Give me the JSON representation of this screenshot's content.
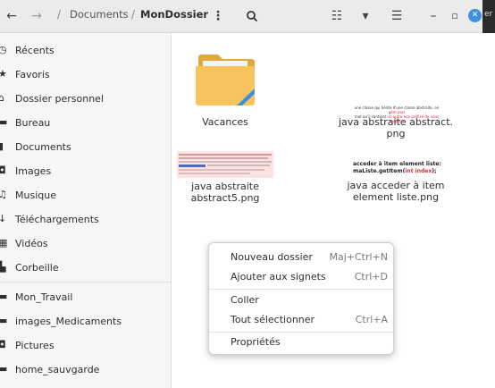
{
  "header": {
    "back_glyph": "←",
    "forward_glyph": "→",
    "breadcrumb": [
      "Documents",
      "MonDossier"
    ],
    "separator": "/",
    "menu_glyph": "⋮",
    "search_glyph": "🔍",
    "view_glyph": "☷",
    "sort_glyph": "▾",
    "options_glyph": "☰",
    "minimize_glyph": "–",
    "maximize_glyph": "▫",
    "close_glyph": "✕",
    "close_color": "#3b8ee0"
  },
  "sidebar": {
    "items": [
      {
        "icon": "clock-icon",
        "glyph": "◷",
        "label": "Récents"
      },
      {
        "icon": "star-icon",
        "glyph": "★",
        "label": "Favoris"
      },
      {
        "icon": "home-icon",
        "glyph": "⌂",
        "label": "Dossier personnel"
      },
      {
        "icon": "desktop-icon",
        "glyph": "▬",
        "label": "Bureau"
      },
      {
        "icon": "document-icon",
        "glyph": "▮",
        "label": "Documents"
      },
      {
        "icon": "camera-icon",
        "glyph": "◘",
        "label": "Images"
      },
      {
        "icon": "music-icon",
        "glyph": "♫",
        "label": "Musique"
      },
      {
        "icon": "download-icon",
        "glyph": "↓",
        "label": "Téléchargements"
      },
      {
        "icon": "film-icon",
        "glyph": "▦",
        "label": "Vidéos"
      },
      {
        "icon": "trash-icon",
        "glyph": "▙",
        "label": "Corbeille"
      },
      {
        "icon": "folder-icon",
        "glyph": "▬",
        "label": "Mon_Travail"
      },
      {
        "icon": "folder-icon",
        "glyph": "▬",
        "label": "images_Medicaments"
      },
      {
        "icon": "pictures-icon",
        "glyph": "◘",
        "label": "Pictures"
      },
      {
        "icon": "folder-icon",
        "glyph": "▬",
        "label": "home_sauvgarde"
      }
    ]
  },
  "files": [
    {
      "name": "Vacances",
      "kind": "folder"
    },
    {
      "name_line1": "java abstraite abstract.",
      "name_line2": "png",
      "kind": "image",
      "thumb_line1": "une classe qui hérite d'une classe abstraite, on ",
      "thumb_red": "gère plus",
      "thumb_line2": "mot qu'il contient ",
      "thumb_red2": "un autre non préfixé de vous redéfinir"
    },
    {
      "name_line1": "java abstraite",
      "name_line2": "abstract5.png",
      "kind": "image"
    },
    {
      "name_line1": "java acceder à item",
      "name_line2": "element liste.png",
      "kind": "image",
      "thumb_line1": "acceder à item element liste:",
      "thumb_line2a": "maListe.getItem(",
      "thumb_line2b": "int index",
      "thumb_line2c": ");"
    }
  ],
  "context_menu": {
    "items": [
      {
        "label": "Nouveau dossier",
        "shortcut": "Maj+Ctrl+N"
      },
      {
        "label": "Ajouter aux signets",
        "shortcut": "Ctrl+D"
      },
      {
        "label": "Coller",
        "shortcut": ""
      },
      {
        "label": "Tout sélectionner",
        "shortcut": "Ctrl+A"
      },
      {
        "label": "Propriétés",
        "shortcut": ""
      }
    ]
  },
  "right_strip_text": "er"
}
